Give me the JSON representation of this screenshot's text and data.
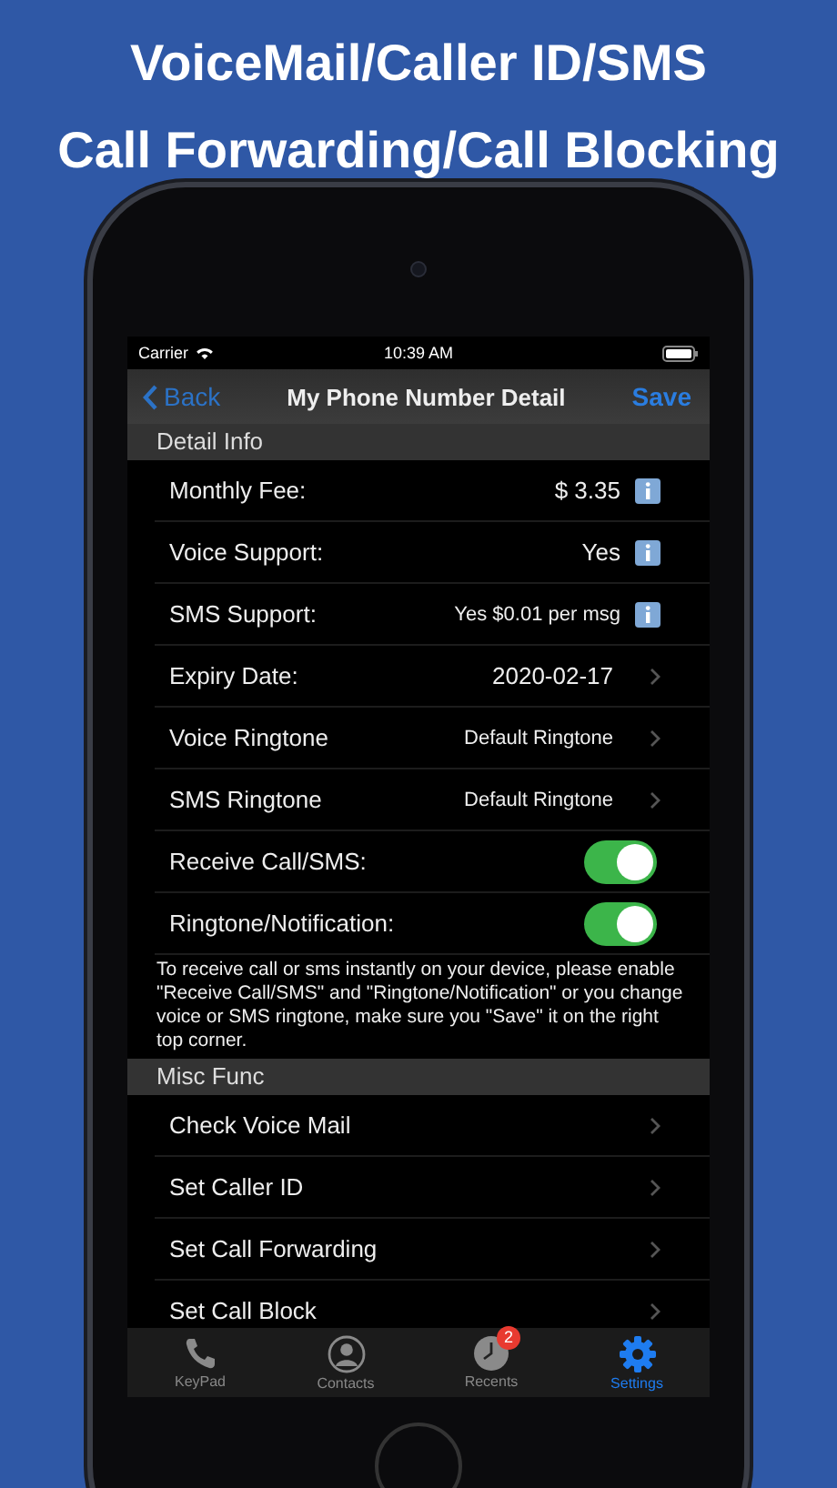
{
  "headline": [
    "VoiceMail/Caller ID/SMS",
    "Call Forwarding/Call Blocking"
  ],
  "status_bar": {
    "carrier": "Carrier",
    "time": "10:39 AM"
  },
  "nav": {
    "back": "Back",
    "title": "My Phone Number Detail",
    "action": "Save"
  },
  "sections": [
    {
      "header": "Detail Info",
      "rows": [
        {
          "kind": "info",
          "label": "Monthly Fee:",
          "value": "$ 3.35"
        },
        {
          "kind": "info",
          "label": "Voice Support:",
          "value": "Yes"
        },
        {
          "kind": "info",
          "label": "SMS Support:",
          "value": "Yes $0.01 per msg",
          "small": true
        },
        {
          "kind": "disclosure",
          "label": "Expiry Date:",
          "value": "2020-02-17"
        },
        {
          "kind": "disclosure",
          "label": "Voice Ringtone",
          "value": "Default Ringtone",
          "small": true
        },
        {
          "kind": "disclosure",
          "label": "SMS Ringtone",
          "value": "Default Ringtone",
          "small": true
        },
        {
          "kind": "toggle",
          "label": "Receive Call/SMS:",
          "on": true
        },
        {
          "kind": "toggle",
          "label": "Ringtone/Notification:",
          "on": true
        }
      ],
      "footer": "To receive call or sms instantly on your device, please enable \"Receive Call/SMS\" and \"Ringtone/Notification\" or you change voice or SMS ringtone,  make sure you \"Save\" it on the right top corner."
    },
    {
      "header": "Misc Func",
      "rows": [
        {
          "kind": "disclosure",
          "label": "Check Voice Mail"
        },
        {
          "kind": "disclosure",
          "label": "Set Caller ID"
        },
        {
          "kind": "disclosure",
          "label": "Set Call Forwarding"
        },
        {
          "kind": "disclosure",
          "label": "Set Call Block"
        }
      ]
    }
  ],
  "tabs": [
    {
      "kind": "keypad",
      "label": "KeyPad",
      "selected": false
    },
    {
      "kind": "contacts",
      "label": "Contacts",
      "selected": false
    },
    {
      "kind": "recents",
      "label": "Recents",
      "selected": false,
      "badge": "2"
    },
    {
      "kind": "settings",
      "label": "Settings",
      "selected": true
    }
  ]
}
